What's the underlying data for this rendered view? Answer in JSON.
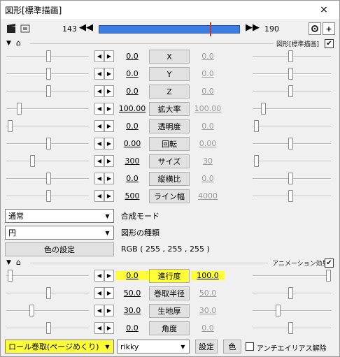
{
  "window": {
    "title": "図形[標準描画]",
    "close_glyph": "×"
  },
  "timeline": {
    "start_frame": "143",
    "end_frame": "190",
    "prev_glyph": "◀◀",
    "next_glyph": "▶▶",
    "gear_icon": "gear-icon",
    "plus_glyph": "+"
  },
  "section1": {
    "label": "図形[標準描画]",
    "checked": "✔"
  },
  "params": [
    {
      "name": "X",
      "left": "0.0",
      "right": "0.0"
    },
    {
      "name": "Y",
      "left": "0.0",
      "right": "0.0"
    },
    {
      "name": "Z",
      "left": "0.0",
      "right": "0.0"
    },
    {
      "name": "拡大率",
      "left": "100.00",
      "right": "100.00"
    },
    {
      "name": "透明度",
      "left": "0.0",
      "right": "0.0"
    },
    {
      "name": "回転",
      "left": "0.00",
      "right": "0.00"
    },
    {
      "name": "サイズ",
      "left": "300",
      "right": "30"
    },
    {
      "name": "縦横比",
      "left": "0.0",
      "right": "0.0"
    },
    {
      "name": "ライン幅",
      "left": "500",
      "right": "4000"
    }
  ],
  "blend": {
    "value": "通常",
    "label": "合成モード"
  },
  "shape": {
    "value": "円",
    "label": "図形の種類"
  },
  "color": {
    "button": "色の設定",
    "rgb": "RGB ( 255 , 255 , 255 )"
  },
  "section2": {
    "label": "アニメーション効果",
    "checked": "✔"
  },
  "anim_params": [
    {
      "name": "進行度",
      "left": "0.0",
      "right": "100.0"
    },
    {
      "name": "巻取半径",
      "left": "50.0",
      "right": "50.0"
    },
    {
      "name": "生地厚",
      "left": "30.0",
      "right": "30.0"
    },
    {
      "name": "角度",
      "left": "0.0",
      "right": "0.0"
    }
  ],
  "effect": {
    "type": "ロール巻取(ページめくり)",
    "author": "rikky",
    "settings": "設定",
    "color": "色",
    "antialias": "アンチエイリアス解除"
  },
  "colors": {
    "highlight": "#ffff37",
    "timeline_bar": "#3c7de4"
  }
}
